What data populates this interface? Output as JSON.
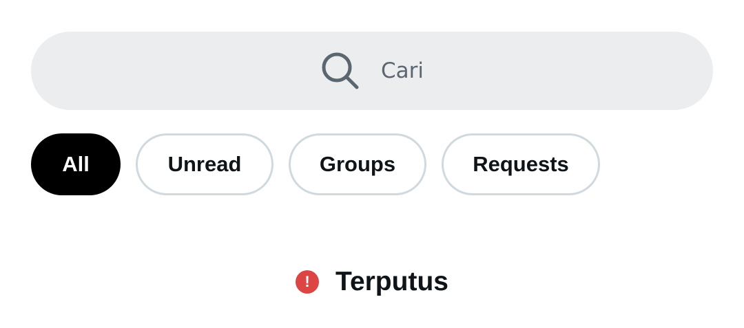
{
  "search": {
    "placeholder": "Cari",
    "icon": "search-icon"
  },
  "filters": [
    {
      "label": "All",
      "active": true
    },
    {
      "label": "Unread",
      "active": false
    },
    {
      "label": "Groups",
      "active": false
    },
    {
      "label": "Requests",
      "active": false
    }
  ],
  "status": {
    "icon": "error-icon",
    "icon_glyph": "!",
    "text": "Terputus",
    "color": "#dd4444"
  },
  "colors": {
    "search_bg": "#ecedef",
    "chip_border": "#cfd9de",
    "active_chip_bg": "#000000",
    "text_primary": "#0f1419",
    "placeholder": "#5c6670"
  }
}
